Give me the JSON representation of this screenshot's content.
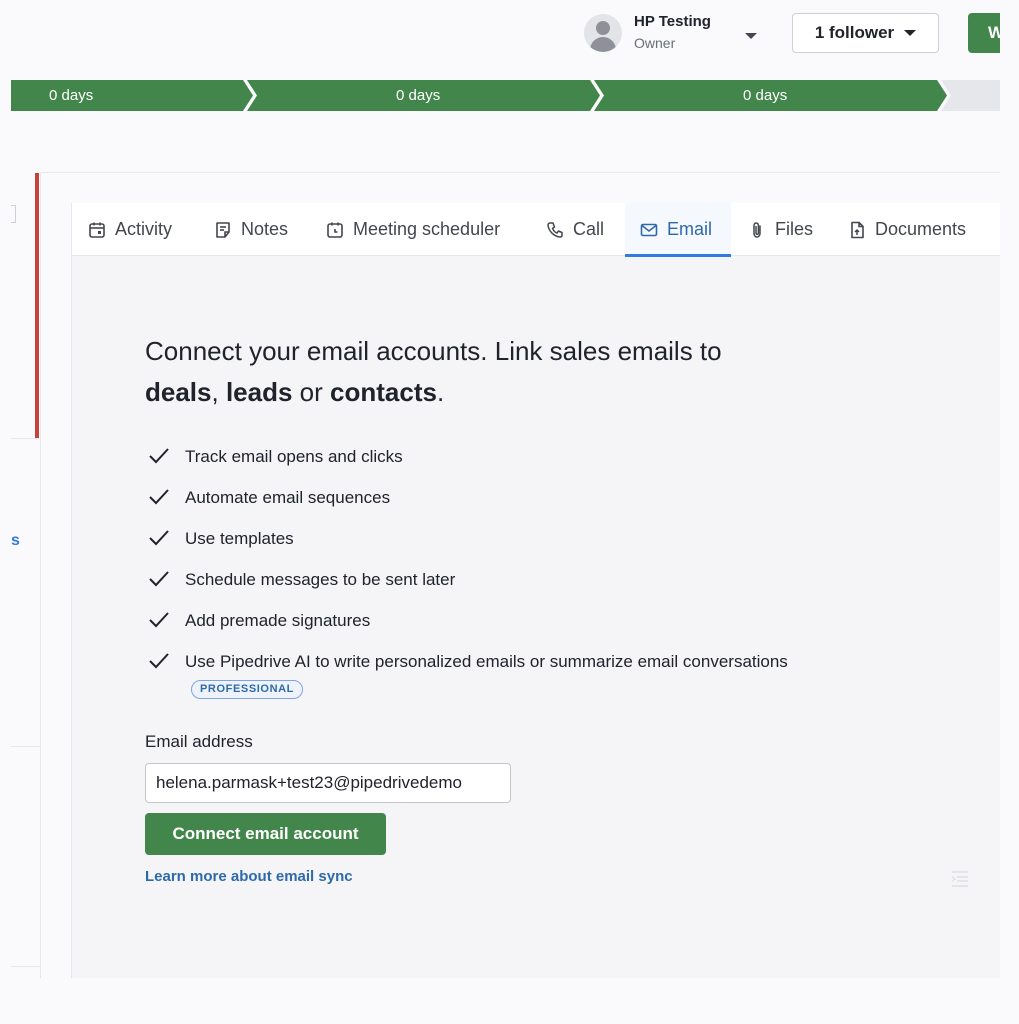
{
  "header": {
    "owner_name": "HP Testing",
    "owner_role": "Owner",
    "follower_label": "1 follower",
    "won_label": "W"
  },
  "stages": [
    {
      "label": "0 days",
      "state": "complete"
    },
    {
      "label": "0 days",
      "state": "complete"
    },
    {
      "label": "0 days",
      "state": "complete"
    },
    {
      "label": "",
      "state": "upcoming"
    }
  ],
  "left_panel": {
    "partial_text": "s"
  },
  "tabs": [
    {
      "label": "Activity",
      "icon": "calendar-icon"
    },
    {
      "label": "Notes",
      "icon": "note-icon"
    },
    {
      "label": "Meeting scheduler",
      "icon": "calendar-clock-icon"
    },
    {
      "label": "Call",
      "icon": "phone-icon"
    },
    {
      "label": "Email",
      "icon": "envelope-icon",
      "active": true
    },
    {
      "label": "Files",
      "icon": "paperclip-icon"
    },
    {
      "label": "Documents",
      "icon": "document-icon"
    }
  ],
  "email_panel": {
    "headline_start": "Connect your email accounts. Link sales emails to",
    "headline_deals": "deals",
    "headline_sep1": ", ",
    "headline_leads": "leads",
    "headline_or": " or ",
    "headline_contacts": "contacts",
    "headline_end": ".",
    "features": [
      "Track email opens and clicks",
      "Automate email sequences",
      "Use templates",
      "Schedule messages to be sent later",
      "Add premade signatures",
      "Use Pipedrive AI to write personalized emails or summarize email conversations"
    ],
    "feature_badge": "PROFESSIONAL",
    "email_label": "Email address",
    "email_value": "helena.parmask+test23@pipedrivedemo",
    "connect_button": "Connect email account",
    "learn_more": "Learn more about email sync"
  },
  "colors": {
    "accent_green": "#43864b",
    "link_blue": "#2e6aa9",
    "deal_red": "#c4443c"
  }
}
